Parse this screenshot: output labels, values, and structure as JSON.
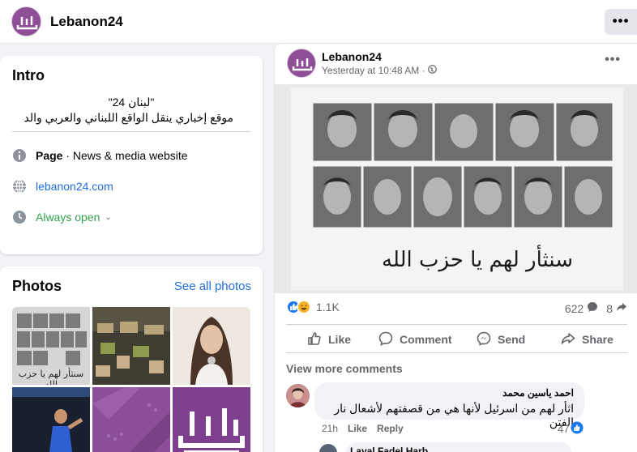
{
  "header": {
    "page_name": "Lebanon24",
    "more_icon": "more-horizontal-icon"
  },
  "intro": {
    "title": "Intro",
    "bio_line1": "\"لبنان 24\"",
    "bio_line2": "موقع إخباري ينقل الواقع اللبناني والعربي والد",
    "category_label": "Page",
    "category_value": " · News & media website",
    "website": "lebanon24.com",
    "hours": "Always open"
  },
  "photos": {
    "title": "Photos",
    "see_all": "See all photos",
    "poster_caption": "سنثأر لهم يا حزب الله"
  },
  "post": {
    "author": "Lebanon24",
    "time": "Yesterday at 10:48 AM",
    "time_separator": " · ",
    "privacy_icon": "globe-icon",
    "image_caption": "سنثأر لهم يا حزب الله",
    "reaction_count": "1.1K",
    "comment_count": "622",
    "share_count": "8",
    "actions": {
      "like": "Like",
      "comment": "Comment",
      "send": "Send",
      "share": "Share"
    },
    "view_more_comments": "View more comments",
    "comment": {
      "author": "احمد ياسين محمد",
      "text": "اثأر لهم من اسرئيل لأنها هي من قصفتهم لأشعال نار الفتن",
      "age": "21h",
      "like": "Like",
      "reply": "Reply",
      "likes": "47"
    },
    "reply": {
      "author": "Layal Fadel Harb"
    }
  },
  "colors": {
    "brand_purple": "#8e4f97",
    "link_blue": "#216fdb",
    "open_green": "#31a24c"
  }
}
